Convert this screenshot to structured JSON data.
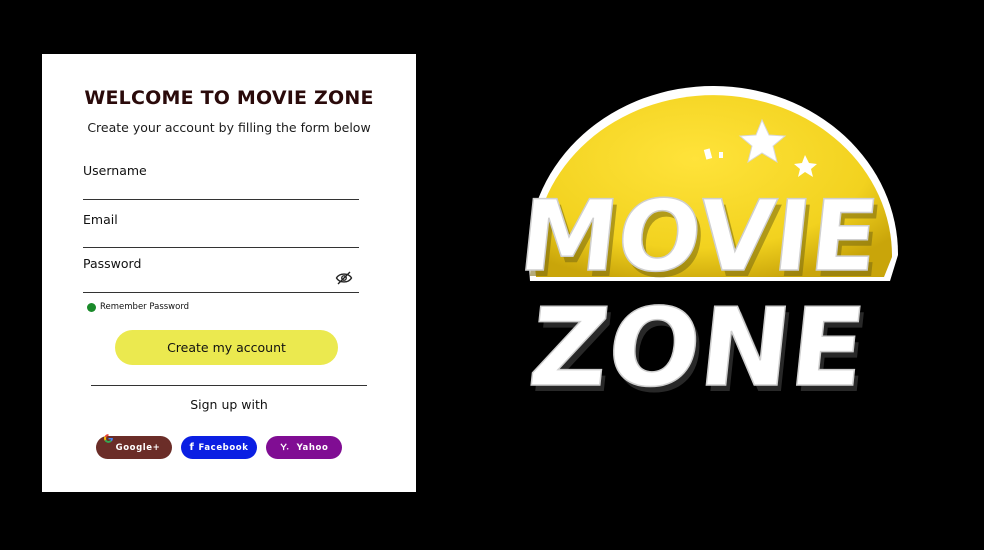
{
  "form": {
    "title": "WELCOME TO MOVIE ZONE",
    "subtitle": "Create your account by filling the form below",
    "fields": {
      "username_label": "Username",
      "email_label": "Email",
      "password_label": "Password"
    },
    "remember_label": "Remember Password",
    "submit_label": "Create my account",
    "signup_with_label": "Sign up with",
    "social": {
      "google_label": "Google+",
      "facebook_label": "Facebook",
      "yahoo_label": "Yahoo"
    }
  },
  "logo": {
    "line1": "MOVIE",
    "line2": "ZONE"
  },
  "icons": {
    "password_toggle": "eye-off-icon",
    "remember": "checked-dot-icon",
    "google": "google-icon",
    "facebook": "facebook-icon",
    "yahoo": "yahoo-icon"
  },
  "colors": {
    "background": "#000000",
    "card": "#ffffff",
    "title": "#2a0a0a",
    "submit": "#ebe94f",
    "google": "#6b2d28",
    "facebook": "#0b1fe3",
    "yahoo": "#800d93",
    "remember_dot": "#1a8a2a",
    "logo_yellow": "#f2d21f"
  }
}
